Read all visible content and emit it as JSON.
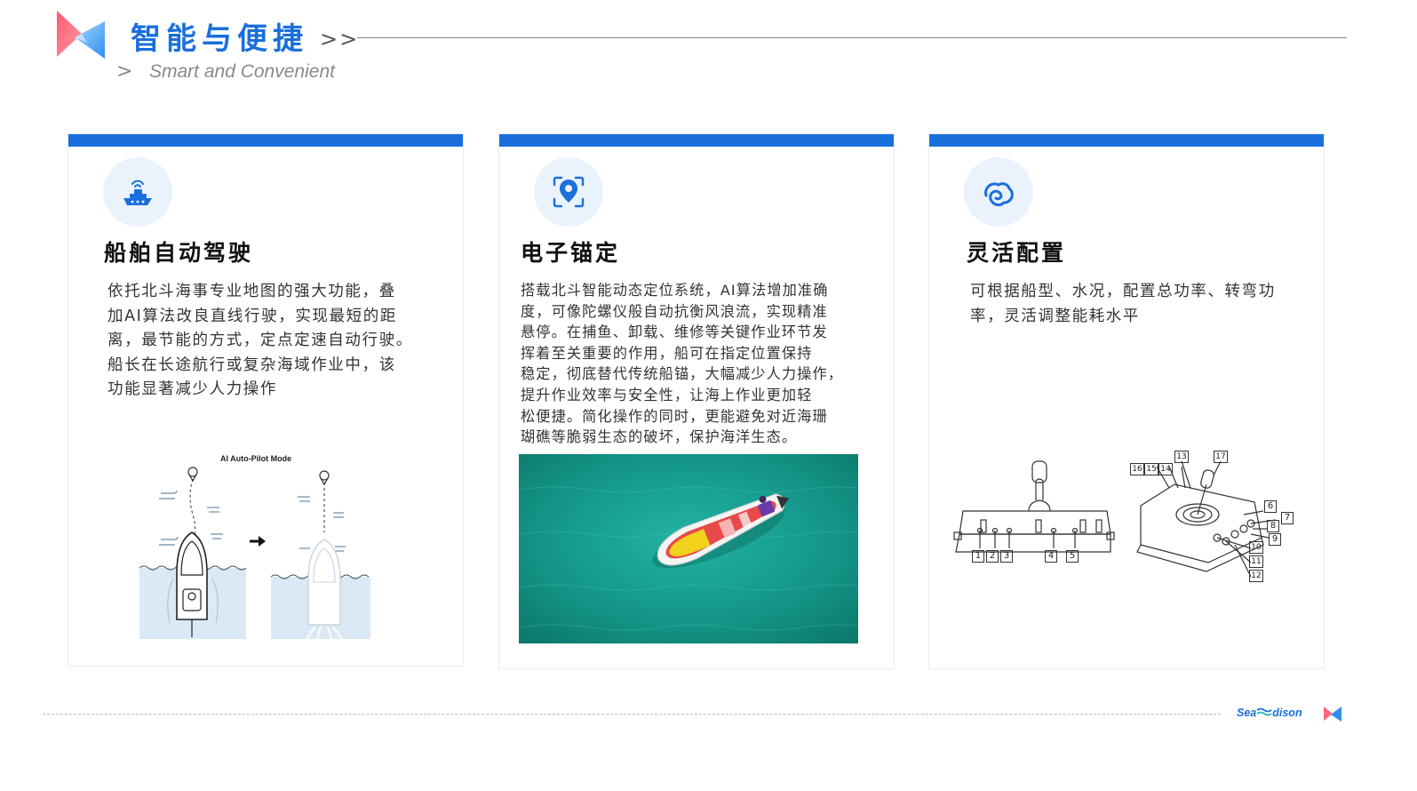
{
  "header": {
    "title": "智能与便捷",
    "arrows": ">>",
    "sub_arrow": ">",
    "subtitle": "Smart and Convenient"
  },
  "cards": [
    {
      "icon": "boat-icon",
      "title": "船舶自动驾驶",
      "lines": [
        "依托北斗海事专业地图的强大功能，叠",
        "加AI算法改良直线行驶，实现最短的距",
        "离，最节能的方式，定点定速自动行驶。",
        "船长在长途航行或复杂海域作业中，该",
        "功能显著减少人力操作"
      ],
      "figure_label": "AI Auto-Pilot Mode"
    },
    {
      "icon": "location-pin-icon",
      "title": "电子锚定",
      "lines": [
        "搭载北斗智能动态定位系统，AI算法增加准确",
        "度，可像陀螺仪般自动抗衡风浪流，实现精准",
        "悬停。在捕鱼、卸载、维修等关键作业环节发",
        "挥着至关重要的作用，船可在指定位置保持",
        "稳定，彻底替代传统船锚，大幅减少人力操作，",
        "提升作业效率与安全性，让海上作业更加轻",
        "松便捷。简化操作的同时，更能避免对近海珊",
        "瑚礁等脆弱生态的破坏，保护海洋生态。"
      ]
    },
    {
      "icon": "swirl-icon",
      "title": "灵活配置",
      "lines": [
        "可根据船型、水况，配置总功率、转弯功",
        "率，灵活调整能耗水平"
      ],
      "callouts_left": [
        "1",
        "2",
        "3",
        "4",
        "5"
      ],
      "callouts_right": [
        "16",
        "15",
        "14",
        "13",
        "17",
        "6",
        "7",
        "8",
        "9",
        "10",
        "11",
        "12"
      ]
    }
  ],
  "footer": {
    "brand_left": "Sea",
    "brand_right": "dison"
  },
  "colors": {
    "accent": "#1a6fdc",
    "icon_bg": "#eaf2fc",
    "sea": "#1aa59a"
  }
}
